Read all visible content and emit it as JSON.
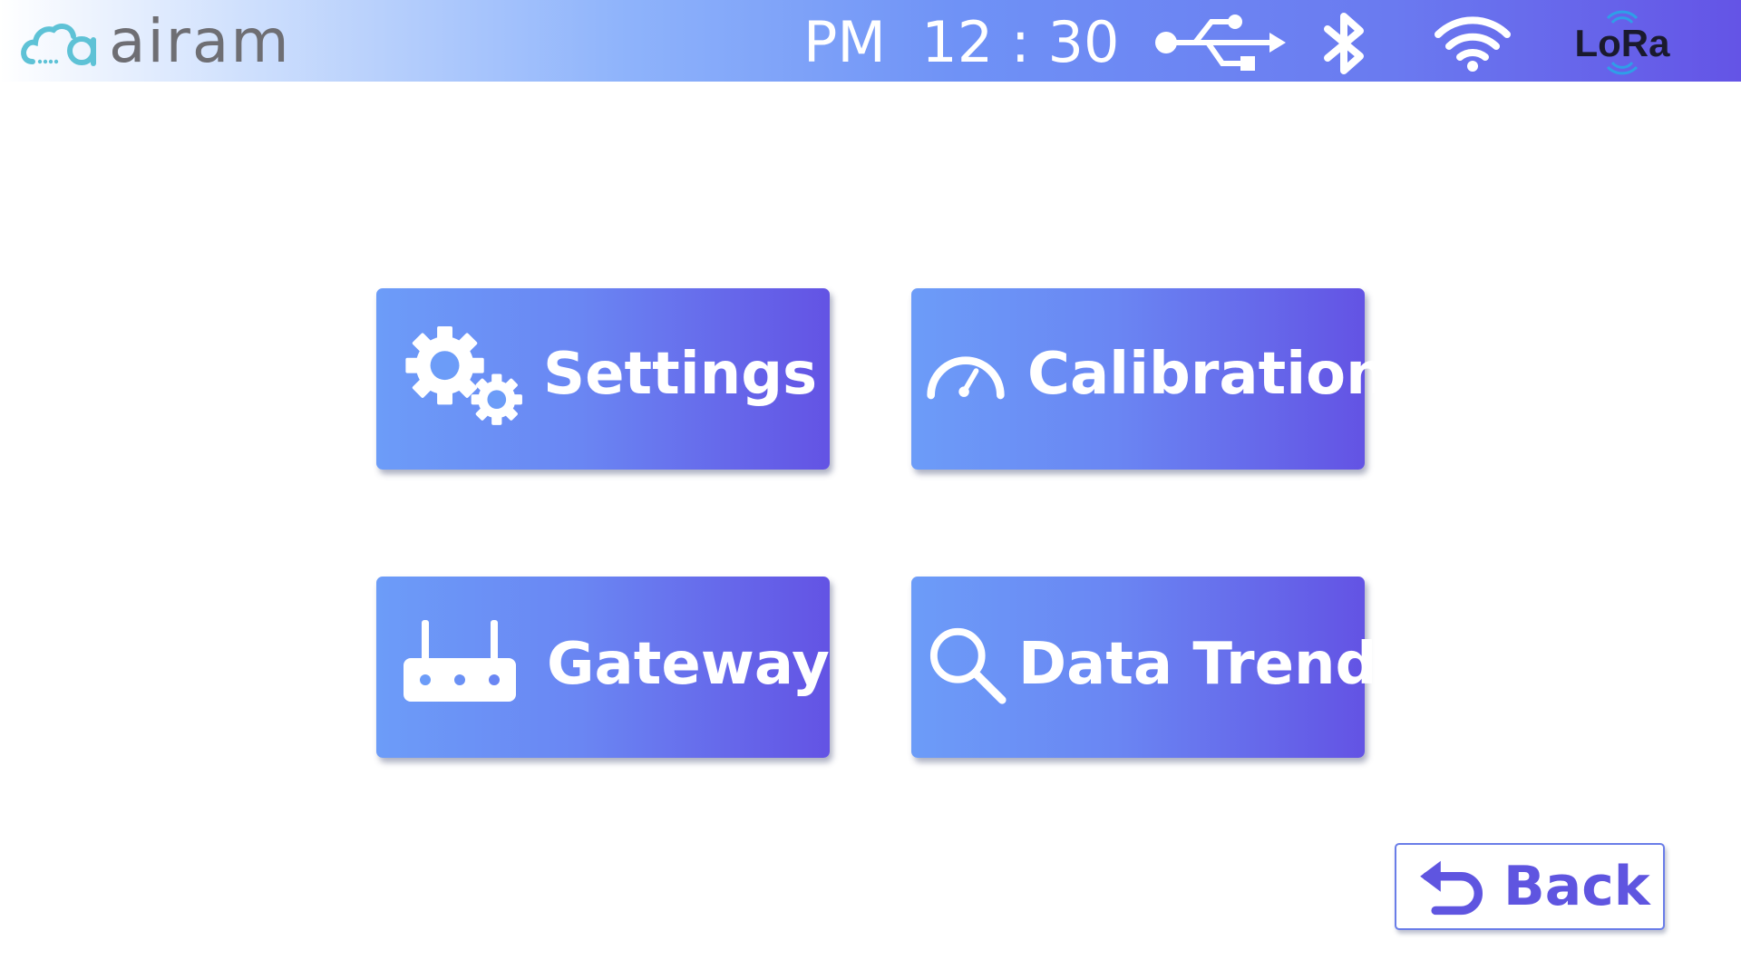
{
  "header": {
    "brand": "airam",
    "time_text": "PM  12 : 30",
    "status_icons": [
      "usb-icon",
      "bluetooth-icon",
      "wifi-icon",
      "lora-icon"
    ],
    "lora_label": "LoRa"
  },
  "menu": {
    "tiles": [
      {
        "label": "Settings",
        "icon": "gears-icon"
      },
      {
        "label": "Calibration",
        "icon": "gauge-icon"
      },
      {
        "label": "Gateway",
        "icon": "router-icon"
      },
      {
        "label": "Data Trend",
        "icon": "magnifier-icon"
      }
    ]
  },
  "footer": {
    "back_label": "Back",
    "back_icon": "return-arrow-icon"
  },
  "colors": {
    "tile_gradient_start": "#6c9cf8",
    "tile_gradient_end": "#6353e4",
    "header_gradient_end": "#6454e6",
    "brand_cloud": "#5ec2d6",
    "brand_text": "#6e6e73",
    "back_text": "#5f55e0"
  }
}
